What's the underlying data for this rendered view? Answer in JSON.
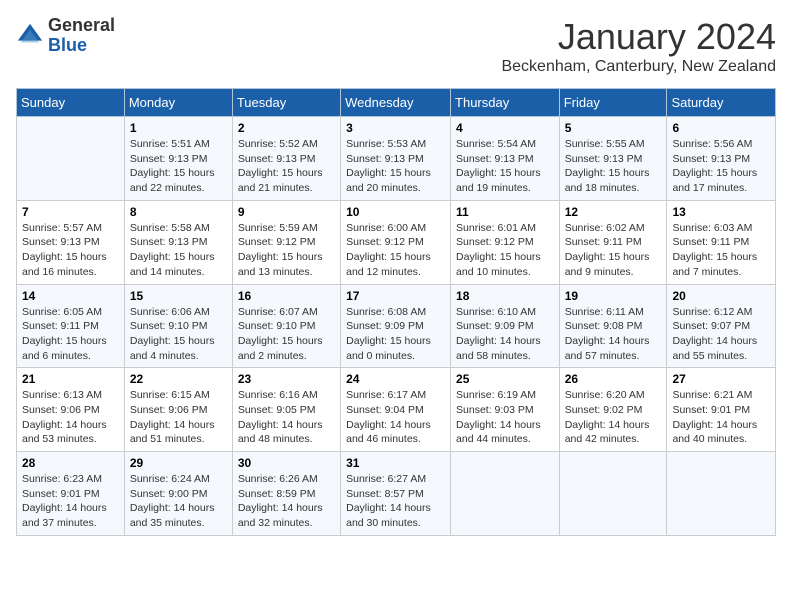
{
  "header": {
    "logo_general": "General",
    "logo_blue": "Blue",
    "month_title": "January 2024",
    "location": "Beckenham, Canterbury, New Zealand"
  },
  "weekdays": [
    "Sunday",
    "Monday",
    "Tuesday",
    "Wednesday",
    "Thursday",
    "Friday",
    "Saturday"
  ],
  "weeks": [
    [
      {
        "day": "",
        "info": ""
      },
      {
        "day": "1",
        "info": "Sunrise: 5:51 AM\nSunset: 9:13 PM\nDaylight: 15 hours\nand 22 minutes."
      },
      {
        "day": "2",
        "info": "Sunrise: 5:52 AM\nSunset: 9:13 PM\nDaylight: 15 hours\nand 21 minutes."
      },
      {
        "day": "3",
        "info": "Sunrise: 5:53 AM\nSunset: 9:13 PM\nDaylight: 15 hours\nand 20 minutes."
      },
      {
        "day": "4",
        "info": "Sunrise: 5:54 AM\nSunset: 9:13 PM\nDaylight: 15 hours\nand 19 minutes."
      },
      {
        "day": "5",
        "info": "Sunrise: 5:55 AM\nSunset: 9:13 PM\nDaylight: 15 hours\nand 18 minutes."
      },
      {
        "day": "6",
        "info": "Sunrise: 5:56 AM\nSunset: 9:13 PM\nDaylight: 15 hours\nand 17 minutes."
      }
    ],
    [
      {
        "day": "7",
        "info": "Sunrise: 5:57 AM\nSunset: 9:13 PM\nDaylight: 15 hours\nand 16 minutes."
      },
      {
        "day": "8",
        "info": "Sunrise: 5:58 AM\nSunset: 9:13 PM\nDaylight: 15 hours\nand 14 minutes."
      },
      {
        "day": "9",
        "info": "Sunrise: 5:59 AM\nSunset: 9:12 PM\nDaylight: 15 hours\nand 13 minutes."
      },
      {
        "day": "10",
        "info": "Sunrise: 6:00 AM\nSunset: 9:12 PM\nDaylight: 15 hours\nand 12 minutes."
      },
      {
        "day": "11",
        "info": "Sunrise: 6:01 AM\nSunset: 9:12 PM\nDaylight: 15 hours\nand 10 minutes."
      },
      {
        "day": "12",
        "info": "Sunrise: 6:02 AM\nSunset: 9:11 PM\nDaylight: 15 hours\nand 9 minutes."
      },
      {
        "day": "13",
        "info": "Sunrise: 6:03 AM\nSunset: 9:11 PM\nDaylight: 15 hours\nand 7 minutes."
      }
    ],
    [
      {
        "day": "14",
        "info": "Sunrise: 6:05 AM\nSunset: 9:11 PM\nDaylight: 15 hours\nand 6 minutes."
      },
      {
        "day": "15",
        "info": "Sunrise: 6:06 AM\nSunset: 9:10 PM\nDaylight: 15 hours\nand 4 minutes."
      },
      {
        "day": "16",
        "info": "Sunrise: 6:07 AM\nSunset: 9:10 PM\nDaylight: 15 hours\nand 2 minutes."
      },
      {
        "day": "17",
        "info": "Sunrise: 6:08 AM\nSunset: 9:09 PM\nDaylight: 15 hours\nand 0 minutes."
      },
      {
        "day": "18",
        "info": "Sunrise: 6:10 AM\nSunset: 9:09 PM\nDaylight: 14 hours\nand 58 minutes."
      },
      {
        "day": "19",
        "info": "Sunrise: 6:11 AM\nSunset: 9:08 PM\nDaylight: 14 hours\nand 57 minutes."
      },
      {
        "day": "20",
        "info": "Sunrise: 6:12 AM\nSunset: 9:07 PM\nDaylight: 14 hours\nand 55 minutes."
      }
    ],
    [
      {
        "day": "21",
        "info": "Sunrise: 6:13 AM\nSunset: 9:06 PM\nDaylight: 14 hours\nand 53 minutes."
      },
      {
        "day": "22",
        "info": "Sunrise: 6:15 AM\nSunset: 9:06 PM\nDaylight: 14 hours\nand 51 minutes."
      },
      {
        "day": "23",
        "info": "Sunrise: 6:16 AM\nSunset: 9:05 PM\nDaylight: 14 hours\nand 48 minutes."
      },
      {
        "day": "24",
        "info": "Sunrise: 6:17 AM\nSunset: 9:04 PM\nDaylight: 14 hours\nand 46 minutes."
      },
      {
        "day": "25",
        "info": "Sunrise: 6:19 AM\nSunset: 9:03 PM\nDaylight: 14 hours\nand 44 minutes."
      },
      {
        "day": "26",
        "info": "Sunrise: 6:20 AM\nSunset: 9:02 PM\nDaylight: 14 hours\nand 42 minutes."
      },
      {
        "day": "27",
        "info": "Sunrise: 6:21 AM\nSunset: 9:01 PM\nDaylight: 14 hours\nand 40 minutes."
      }
    ],
    [
      {
        "day": "28",
        "info": "Sunrise: 6:23 AM\nSunset: 9:01 PM\nDaylight: 14 hours\nand 37 minutes."
      },
      {
        "day": "29",
        "info": "Sunrise: 6:24 AM\nSunset: 9:00 PM\nDaylight: 14 hours\nand 35 minutes."
      },
      {
        "day": "30",
        "info": "Sunrise: 6:26 AM\nSunset: 8:59 PM\nDaylight: 14 hours\nand 32 minutes."
      },
      {
        "day": "31",
        "info": "Sunrise: 6:27 AM\nSunset: 8:57 PM\nDaylight: 14 hours\nand 30 minutes."
      },
      {
        "day": "",
        "info": ""
      },
      {
        "day": "",
        "info": ""
      },
      {
        "day": "",
        "info": ""
      }
    ]
  ]
}
